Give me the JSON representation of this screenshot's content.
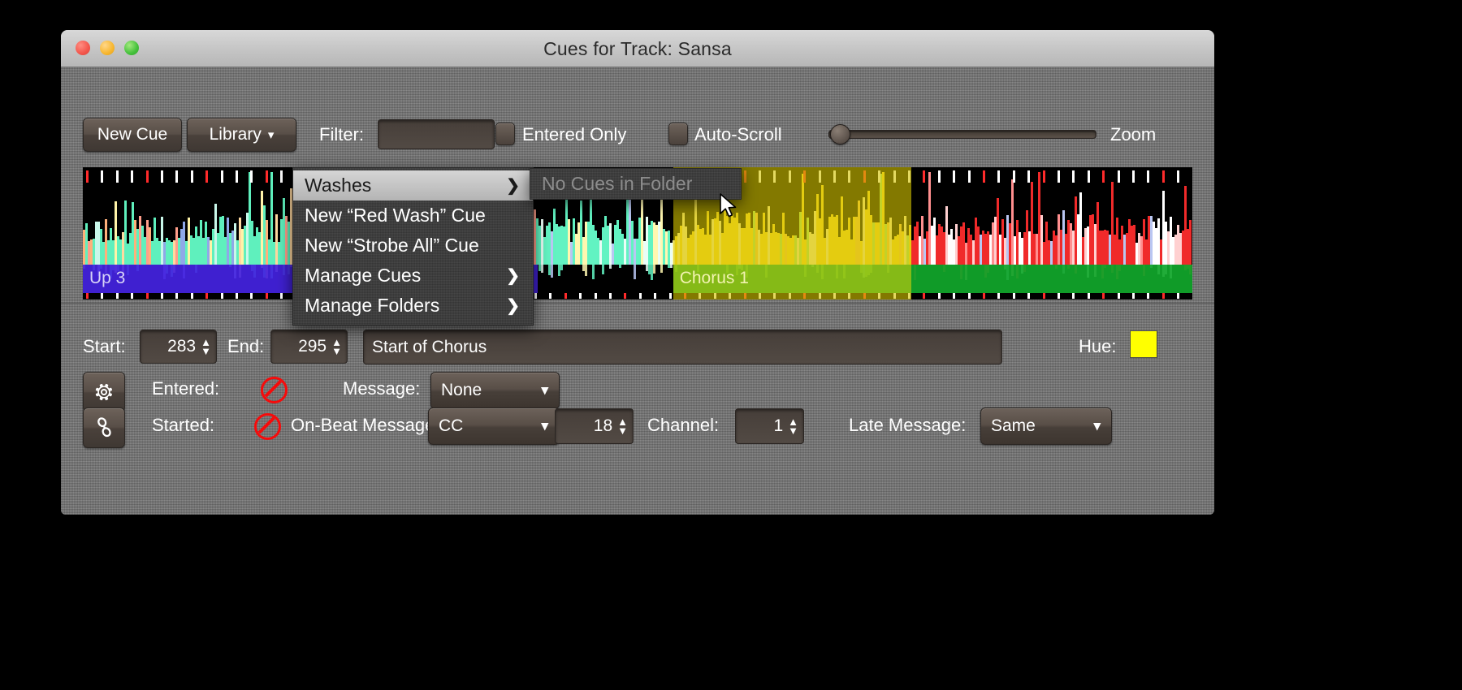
{
  "window": {
    "title": "Cues for Track: Sansa",
    "traffic_lights": [
      "close-light",
      "minimize-light",
      "zoom-light"
    ]
  },
  "toolbar": {
    "new_cue_label": "New Cue",
    "library_label": "Library",
    "library_caret": "▾",
    "filter_label": "Filter:",
    "filter_value": "",
    "filter_placeholder": "",
    "entered_only_label": "Entered Only",
    "entered_only_checked": false,
    "auto_scroll_label": "Auto-Scroll",
    "auto_scroll_checked": false,
    "zoom_label": "Zoom",
    "zoom_value": 2
  },
  "menu": {
    "items": [
      {
        "label": "Washes",
        "arrow": "❯",
        "selected": true,
        "has_submenu": true
      },
      {
        "label": "New “Red Wash” Cue",
        "arrow": "",
        "selected": false,
        "has_submenu": false
      },
      {
        "label": "New “Strobe All” Cue",
        "arrow": "",
        "selected": false,
        "has_submenu": false
      },
      {
        "label": "Manage Cues",
        "arrow": "❯",
        "selected": false,
        "has_submenu": true
      },
      {
        "label": "Manage Folders",
        "arrow": "❯",
        "selected": false,
        "has_submenu": true
      }
    ]
  },
  "submenu": {
    "empty_label": "No Cues in Folder",
    "disabled": true
  },
  "waveform": {
    "cues": [
      {
        "name": "Up 3",
        "band_color": "#4423e2",
        "label_color": "#d7d2f7",
        "start_pct": 0.0,
        "end_pct": 41.0,
        "overlay": false
      },
      {
        "name": "Chorus 1",
        "band_color": "#86c51b",
        "label_color": "#f2f3b0",
        "start_pct": 53.2,
        "end_pct": 74.7,
        "overlay": true,
        "overlay_color": "#d4c400"
      },
      {
        "name": "",
        "band_color": "#11a82b",
        "label_color": "#ffffff",
        "start_pct": 74.7,
        "end_pct": 100.0,
        "overlay": false
      }
    ],
    "scroll_pill": "waveform-scroll-handle"
  },
  "cue_editor": {
    "start_label": "Start:",
    "start_value": "283",
    "end_label": "End:",
    "end_value": "295",
    "comment_value": "Start of Chorus",
    "comment_placeholder": "",
    "hue_label": "Hue:",
    "hue_color": "#ffff00",
    "gear_icon": "gear-icon",
    "link_icon": "link-icon",
    "entered_label": "Entered:",
    "entered_state": "disabled",
    "message_label": "Message:",
    "message_value": "None",
    "started_label": "Started:",
    "started_state": "disabled",
    "onbeat_label": "On-Beat Message:",
    "onbeat_value": "CC",
    "onbeat_number": "18",
    "channel_label": "Channel:",
    "channel_value": "1",
    "late_label": "Late Message:",
    "late_value": "Same"
  }
}
